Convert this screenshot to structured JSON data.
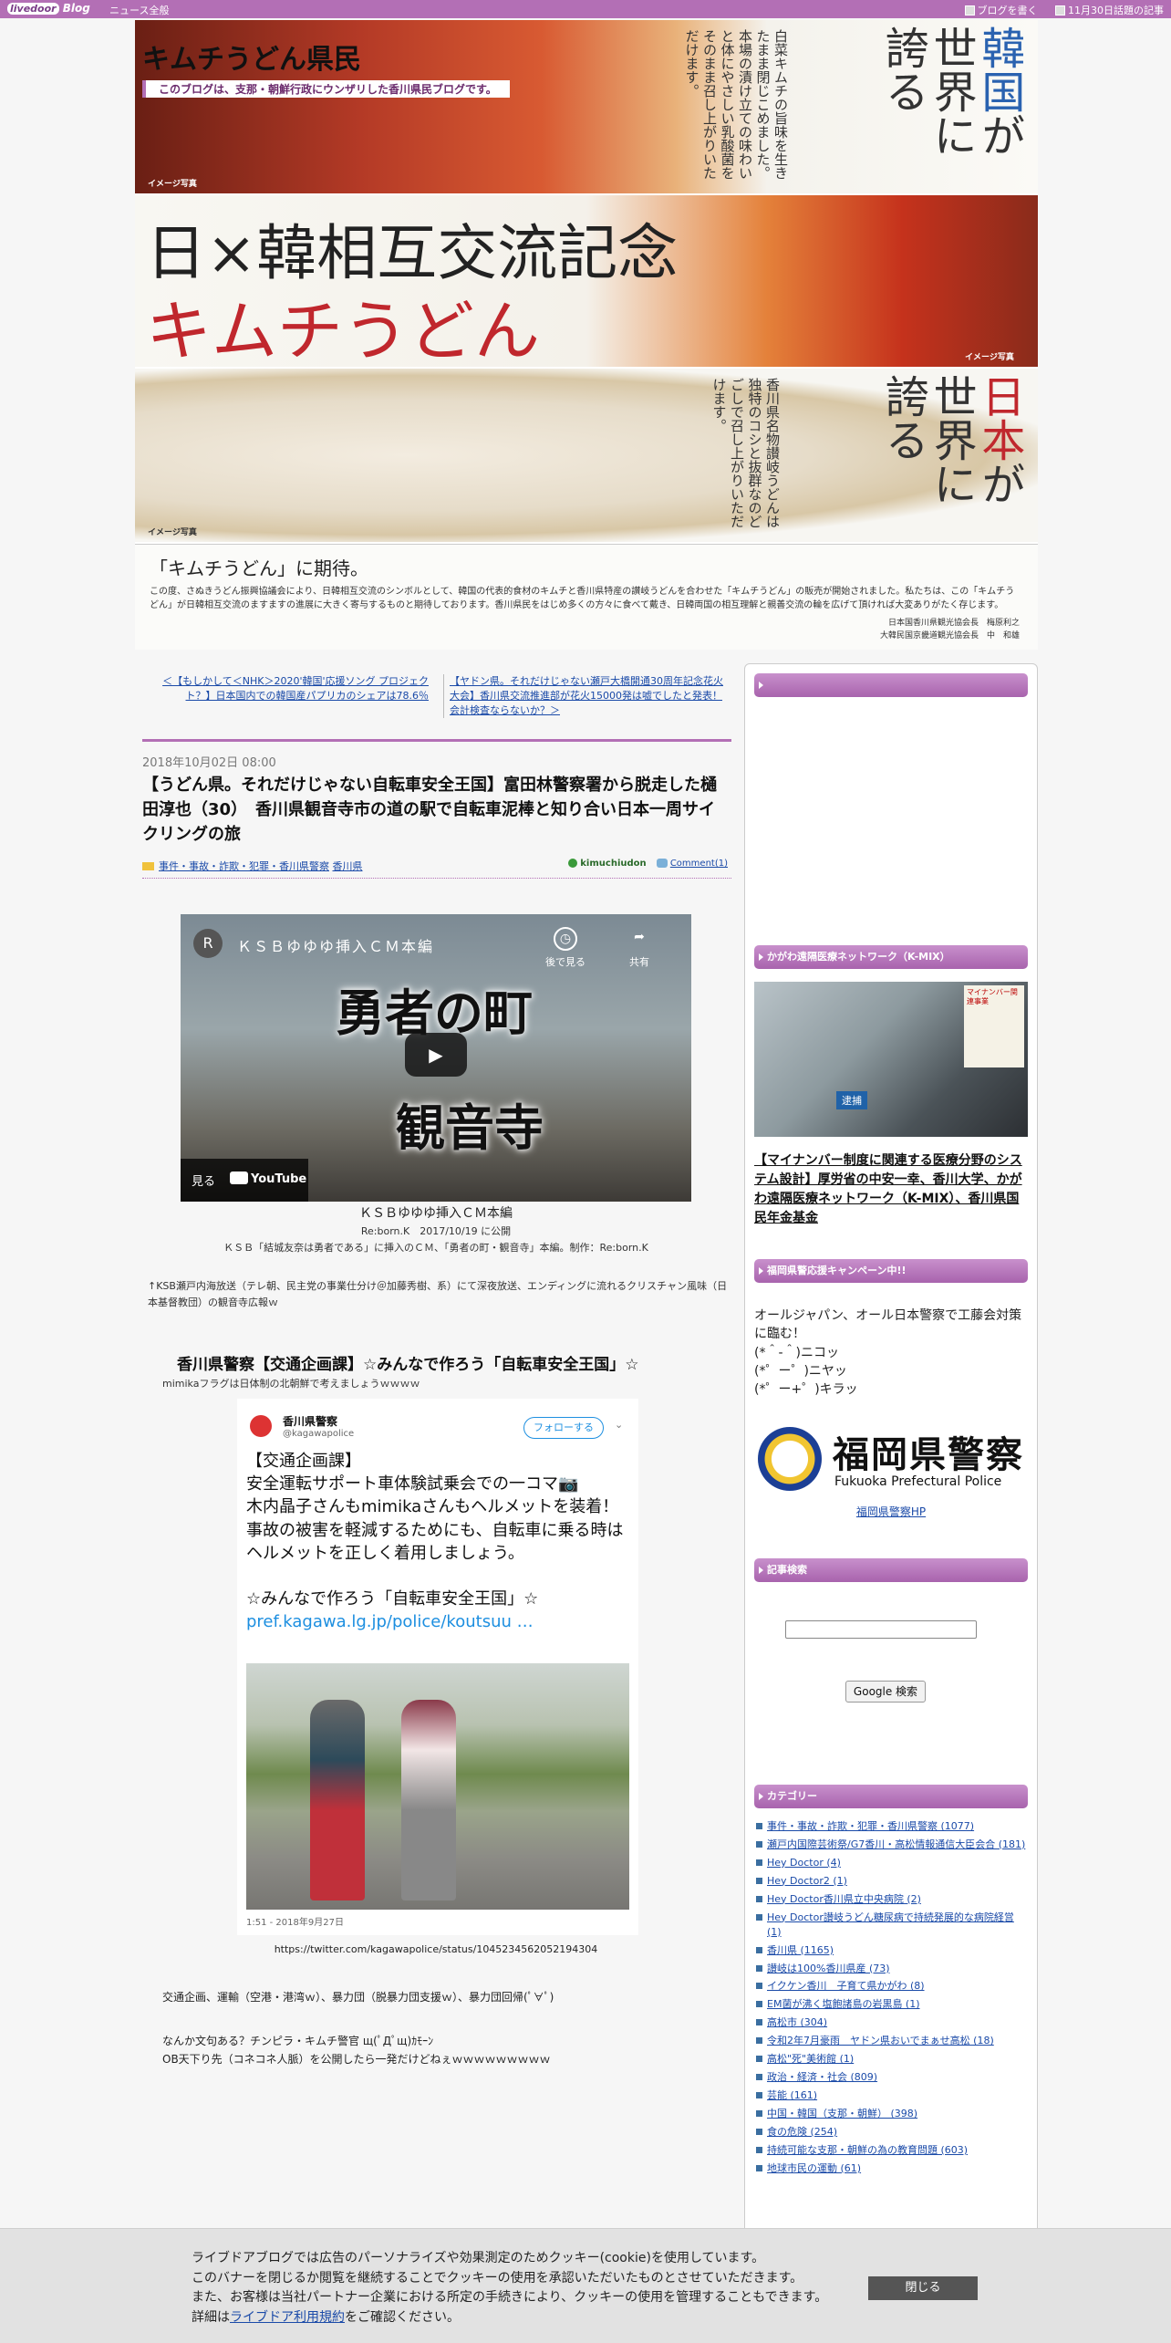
{
  "topbar": {
    "logo": "livedoor",
    "logo_sub": "Blog",
    "news": "ニュース全般",
    "write_blog": "ブログを書く",
    "hot_topics": "11月30日話題の記事"
  },
  "banner": {
    "title": "キムチうどん県民",
    "description": "このブログは、支那・朝鮮行政にウンザリした香川県民ブログです。",
    "image_note": "イメージ写真",
    "korea_pride_1": "韓国",
    "korea_pride_2": "が世界に誇る",
    "korea_copy": "白菜キムチの旨味を生きたまま閉じこめました。本場の漬け立ての味わいと体にやさしい乳酸菌をそのまま召し上がりいただけます。",
    "slogan_1": "日×韓相互交流記念",
    "slogan_2": "キムチうどん",
    "japan_pride_1": "日本",
    "japan_pride_2": "が世界に誇る",
    "japan_copy": "香川県名物讃岐うどんは独特のコシと抜群なのどごしで召し上がりいただけます。",
    "expect_title": "「キムチうどん」に期待。",
    "expect_text": "この度、さぬきうどん振興協議会により、日韓相互交流のシンボルとして、韓国の代表的食材のキムチと香川県特産の讃岐うどんを合わせた「キムチうどん」の販売が開始されました。私たちは、この「キムチうどん」が日韓相互交流のますますの進展に大きく寄与するものと期待しております。香川県民をはじめ多くの方々に食べて戴き、日韓両国の相互理解と親善交流の輪を広げて頂ければ大変ありがたく存じます。",
    "sign_1": "日本国香川県観光協会長　梅原利之",
    "sign_2": "大韓民国京畿道観光協会長　中　和雄"
  },
  "nav": {
    "prev": "＜【もしかして＜NHK＞2020'韓国'応援ソング プロジェクト？】日本国内での韓国産パプリカのシェアは78.6％",
    "next": "【ヤドン県。それだけじゃない瀬戸大橋開通30周年記念花火大会】香川県交流推進部が花火15000発は嘘でしたと発表！会計検査ならないか？＞"
  },
  "post": {
    "date": "2018年10月02日 08:00",
    "title": "【うどん県。それだけじゃない自転車安全王国】富田林警察署から脱走した樋田淳也（30）　香川県観音寺市の道の駅で自転車泥棒と知り合い日本一周サイクリングの旅",
    "category_1": "事件・事故・詐欺・犯罪・香川県警察",
    "category_2": "香川県",
    "author": "kimuchiudon",
    "comment": "Comment(1)"
  },
  "video": {
    "channel_initial": "R",
    "title": "ＫＳＢゆゆゆ挿入ＣＭ本編",
    "later": "後で見る",
    "share": "共有",
    "caption_1": "勇者の町",
    "caption_2": "観音寺",
    "watch_on": "見る",
    "youtube": "YouTube",
    "name": "ＫＳＢゆゆゆ挿入ＣＭ本編",
    "published": "Re:born.K　2017/10/19 に公開",
    "description": "ＫＳＢ「結城友奈は勇者である」に挿入のＣＭ、「勇者の町・観音寺」本編。制作：Re:born.K"
  },
  "ksb_note": "↑KSB瀬戸内海放送（テレ朝、民主党の事業仕分け＠加藤秀樹、系）にて深夜放送、エンディングに流れるクリスチャン風味（日本基督教団）の観音寺広報ｗ",
  "section": {
    "heading": "香川県警察【交通企画課】☆みんなで作ろう「自転車安全王国」☆",
    "sub": "mimikaフラグは日体制の北朝鮮で考えましょうｗｗｗｗ"
  },
  "tweet": {
    "name": "香川県警察",
    "handle": "@kagawapolice",
    "follow": "フォローする",
    "line_1": "【交通企画課】",
    "line_2": "安全運転サポート車体験試乗会での一コマ📷",
    "line_3": "木内晶子さんもmimikaさんもヘルメットを装着！",
    "line_4": "事故の被害を軽減するためにも、自転車に乗る時はヘルメットを正しく着用しましょう。",
    "line_5": "☆みんなで作ろう「自転車安全王国」☆",
    "link": "pref.kagawa.lg.jp/police/koutsuu …",
    "time": "1:51 - 2018年9月27日",
    "url": "https://twitter.com/kagawapolice/status/1045234562052194304"
  },
  "body": {
    "line_1": "交通企画、運輸（空港・港湾ｗ）、暴力団（脱暴力団支援ｗ）、暴力団回帰(ﾟ∀ﾟ)",
    "line_2": "なんか文句ある？チンピラ・キムチ警官 щ(ﾟДﾟщ)ｶﾓｰﾝ",
    "line_3": "OB天下り先（コネコネ人脈）を公開したら一発だけどねぇｗｗｗｗｗｗｗｗｗ"
  },
  "sidebar": {
    "kmix_head": "かがわ遠隔医療ネットワーク（K-MIX）",
    "kmix_caption": "逮捕",
    "kmix_sign": "マイナンバー関連事業",
    "kmix_link": "【マイナンバー制度に関連する医療分野のシステム設計】厚労省の中安一幸、香川大学、かがわ遠隔医療ネットワーク（K-MIX）、香川県国民年金基金",
    "fukuoka_head": "福岡県警応援キャンペーン中!!",
    "fukuoka_line_1": "オールジャパン、オール日本警察で工藤会対策に臨む！",
    "fukuoka_line_2": "(*＾-＾)ニコッ",
    "fukuoka_line_3": "(*゜ー゜)ニヤッ",
    "fukuoka_line_4": "(*゜ー+゜)キラッ",
    "fukuoka_logo_jp": "福岡県警察",
    "fukuoka_logo_en": "Fukuoka Prefectural Police",
    "fukuoka_hp": "福岡県警察HP",
    "search_head": "記事検索",
    "search_button": "Google 検索",
    "category_head": "カテゴリー",
    "categories": [
      "事件・事故・詐欺・犯罪・香川県警察 (1077)",
      "瀬戸内国際芸術祭/G7香川・高松情報通信大臣会合 (181)",
      "Hey Doctor (4)",
      "Hey Doctor2 (1)",
      "Hey Doctor香川県立中央病院 (2)",
      "Hey Doctor讃岐うどん糖尿病で持続発展的な病院経営 (1)",
      "香川県 (1165)",
      "讃岐は100%香川県産 (73)",
      "イクケン香川　子育て県かがわ (8)",
      "EM菌が沸く塩飽諸島の岩黒島 (1)",
      "高松市 (304)",
      "令和2年7月豪雨　ヤドン県おいでまぁせ高松 (18)",
      "高松\"死\"美術館 (1)",
      "政治・経済・社会 (809)",
      "芸能 (161)",
      "中国・韓国（支那・朝鮮） (398)",
      "食の危険 (254)",
      "持続可能な支那・朝鮮の為の教育問題 (603)",
      "地球市民の運動 (61)"
    ]
  },
  "cookie": {
    "line_1": "ライブドアブログでは広告のパーソナライズや効果測定のためクッキー(cookie)を使用しています。",
    "line_2": "このバナーを閉じるか閲覧を継続することでクッキーの使用を承認いただいたものとさせていただきます。",
    "line_3": "また、お客様は当社パートナー企業における所定の手続きにより、クッキーの使用を管理することもできます。",
    "line_4_pre": "詳細は",
    "line_4_link": "ライブドア利用規約",
    "line_4_post": "をご確認ください。",
    "close": "閉じる"
  }
}
